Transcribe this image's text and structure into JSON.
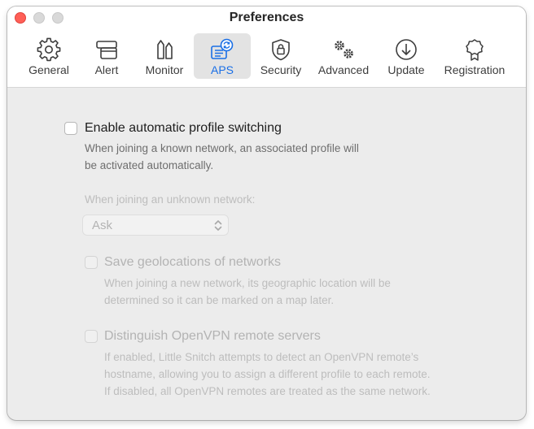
{
  "window": {
    "title": "Preferences"
  },
  "tabs": [
    {
      "label": "General",
      "icon": "gear-icon"
    },
    {
      "label": "Alert",
      "icon": "alert-window-icon"
    },
    {
      "label": "Monitor",
      "icon": "monitor-icon"
    },
    {
      "label": "APS",
      "icon": "aps-profile-switch-icon"
    },
    {
      "label": "Security",
      "icon": "security-lock-icon"
    },
    {
      "label": "Advanced",
      "icon": "advanced-gears-icon"
    },
    {
      "label": "Update",
      "icon": "update-download-icon"
    },
    {
      "label": "Registration",
      "icon": "registration-badge-icon"
    }
  ],
  "selected_tab": "APS",
  "aps": {
    "enable_switching": {
      "label": "Enable automatic profile switching",
      "checked": false,
      "description_lines": [
        "When joining a known network, an associated profile will",
        "be activated automatically."
      ]
    },
    "unknown_network": {
      "label": "When joining an unknown network:",
      "selected_value": "Ask",
      "enabled": false
    },
    "geolocations": {
      "label": "Save geolocations of networks",
      "checked": false,
      "enabled": false,
      "description_lines": [
        "When joining a new network, its geographic location will be",
        "determined so it can be marked on a map later."
      ]
    },
    "openvpn": {
      "label": "Distinguish OpenVPN remote servers",
      "checked": false,
      "enabled": false,
      "description_lines": [
        "If enabled, Little Snitch attempts to detect an OpenVPN remote’s",
        "hostname, allowing you to assign a different profile to each remote.",
        "If disabled, all OpenVPN remotes are treated as the same network."
      ]
    }
  },
  "colors": {
    "accent": "#1a6fe6",
    "close": "#ff5f57",
    "window_bg": "#ececec",
    "toolbar_bg": "#ffffff"
  }
}
